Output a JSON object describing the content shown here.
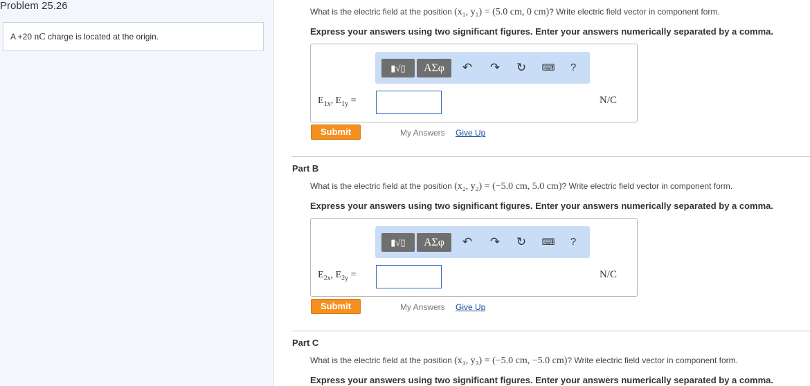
{
  "problem": {
    "title": "Problem 25.26",
    "statement_prefix": "A +20 ",
    "statement_unit": "nC",
    "statement_suffix": " charge is located at the origin."
  },
  "toolbar": {
    "template_label": "▮√▯",
    "greek_label": "ΑΣφ",
    "undo_icon": "undo-icon",
    "redo_icon": "redo-icon",
    "reset_icon": "reset-icon",
    "keyboard_icon": "keyboard-icon",
    "help_label": "?"
  },
  "partA": {
    "question_prefix": "What is the electric field at the position ",
    "question_math": "(x₁, y₁) = (5.0 cm, 0 cm)",
    "question_suffix": "? Write electric field vector in component form.",
    "instruction": "Express your answers using two significant figures. Enter your answers numerically separated by a comma.",
    "label": "E1x, E1y =",
    "input_value": "",
    "unit": "N/C",
    "submit": "Submit",
    "my_answers": "My Answers",
    "give_up": "Give Up"
  },
  "partB": {
    "title": "Part B",
    "question_prefix": "What is the electric field at the position ",
    "question_math": "(x₂, y₂) = (−5.0 cm, 5.0 cm)",
    "question_suffix": "? Write electric field vector in component form.",
    "instruction": "Express your answers using two significant figures. Enter your answers numerically separated by a comma.",
    "label": "E2x, E2y =",
    "input_value": "",
    "unit": "N/C",
    "submit": "Submit",
    "my_answers": "My Answers",
    "give_up": "Give Up"
  },
  "partC": {
    "title": "Part C",
    "question_prefix": "What is the electric field at the position ",
    "question_math": "(x₃, y₃) = (−5.0 cm, −5.0 cm)",
    "question_suffix": "? Write electric field vector in component form.",
    "instruction": "Express your answers using two significant figures. Enter your answers numerically separated by a comma."
  },
  "colors": {
    "submit": "#f5901f",
    "link": "#1b4f9c",
    "toolbar": "#c9ddf7",
    "sidebar": "#f3f7fd"
  }
}
